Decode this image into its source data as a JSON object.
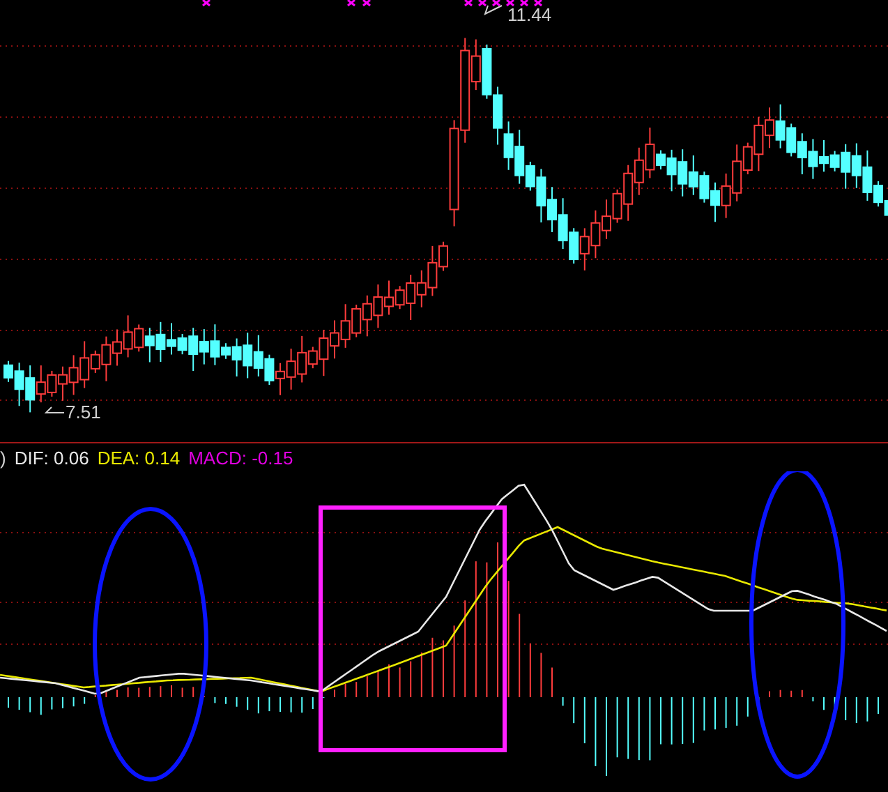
{
  "price_panel": {
    "high_label": "11.44",
    "low_label": "7.51"
  },
  "indicator_panel": {
    "prefix": ")",
    "legend": [
      {
        "label": "DIF: 0.06",
        "color": "#e8e8e8"
      },
      {
        "label": "DEA: 0.14",
        "color": "#e8e800"
      },
      {
        "label": "MACD: -0.15",
        "color": "#e000e0"
      }
    ],
    "annotations": [
      {
        "kind": "ellipse"
      },
      {
        "kind": "rectangle"
      },
      {
        "kind": "ellipse"
      }
    ]
  }
}
